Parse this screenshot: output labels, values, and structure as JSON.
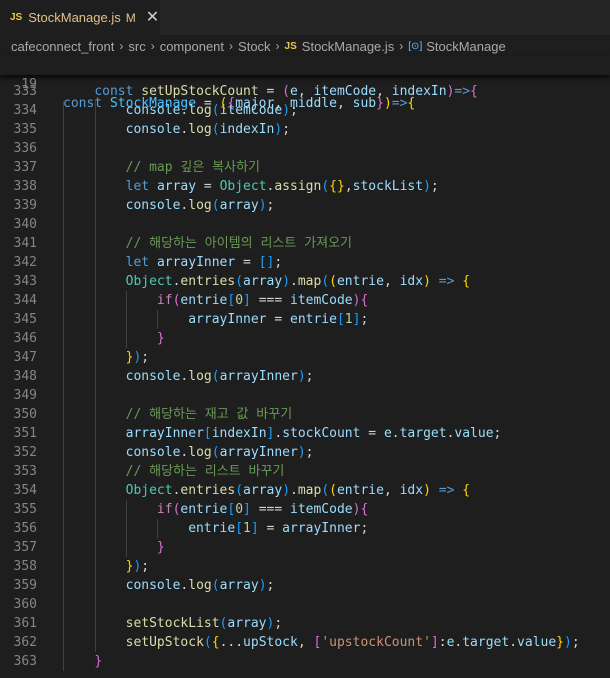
{
  "tab": {
    "icon": "JS",
    "filename": "StockManage.js",
    "modified": "M",
    "close": "✕"
  },
  "breadcrumb": [
    "cafeconnect_front",
    "src",
    "component",
    "Stock",
    "StockManage.js",
    "StockManage"
  ],
  "sticky": {
    "line_number": "19"
  },
  "lines": [
    {
      "n": "333"
    },
    {
      "n": "334"
    },
    {
      "n": "335"
    },
    {
      "n": "336"
    },
    {
      "n": "337"
    },
    {
      "n": "338"
    },
    {
      "n": "339"
    },
    {
      "n": "340"
    },
    {
      "n": "341"
    },
    {
      "n": "342"
    },
    {
      "n": "343"
    },
    {
      "n": "344"
    },
    {
      "n": "345"
    },
    {
      "n": "346"
    },
    {
      "n": "347"
    },
    {
      "n": "348"
    },
    {
      "n": "349"
    },
    {
      "n": "350"
    },
    {
      "n": "351"
    },
    {
      "n": "352"
    },
    {
      "n": "353"
    },
    {
      "n": "354"
    },
    {
      "n": "355"
    },
    {
      "n": "356"
    },
    {
      "n": "357"
    },
    {
      "n": "358"
    },
    {
      "n": "359"
    },
    {
      "n": "360"
    },
    {
      "n": "361"
    },
    {
      "n": "362"
    },
    {
      "n": "363"
    }
  ],
  "tokens": {
    "const": "const",
    "let": "let",
    "if": "if",
    "StockManage": "StockManage",
    "setUpStockCount": "setUpStockCount",
    "major": "major",
    "middle": "middle",
    "sub": "sub",
    "e": "e",
    "itemCode": "itemCode",
    "indexIn": "indexIn",
    "console": "console",
    "log": "log",
    "array": "array",
    "Object": "Object",
    "assign": "assign",
    "stockList": "stockList",
    "arrayInner": "arrayInner",
    "entries": "entries",
    "map": "map",
    "entrie": "entrie",
    "idx": "idx",
    "zero": "0",
    "one": "1",
    "stockCount": "stockCount",
    "target": "target",
    "value": "value",
    "setStockList": "setStockList",
    "setUpStock": "setUpStock",
    "upStock": "upStock",
    "upstockCount_str": "'upstockCount'",
    "cm1": "// map 깊은 복사하기",
    "cm2": "// 해당하는 아이템의 리스트 가져오기",
    "cm3": "// 해당하는 재고 값 바꾸기",
    "cm4": "// 해당하는 리스트 바꾸기"
  }
}
